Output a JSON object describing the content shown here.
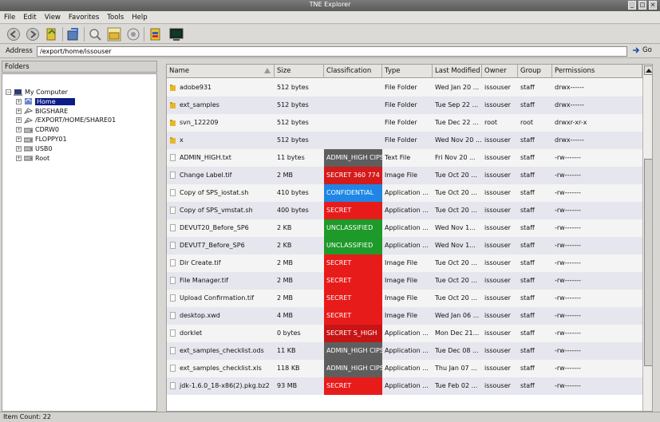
{
  "window": {
    "title": "TNE Explorer"
  },
  "menu": [
    "File",
    "Edit",
    "View",
    "Favorites",
    "Tools",
    "Help"
  ],
  "address": {
    "label": "Address",
    "value": "/export/home/issouser",
    "go_label": "Go"
  },
  "folders": {
    "header": "Folders",
    "tree": [
      {
        "label": "My Computer",
        "depth": 0,
        "expander": "−",
        "icon": "computer-icon",
        "selected": false
      },
      {
        "label": "Home",
        "depth": 1,
        "expander": "+",
        "icon": "home-icon",
        "selected": true
      },
      {
        "label": "BIGSHARE",
        "depth": 1,
        "expander": "+",
        "icon": "share-icon",
        "selected": false
      },
      {
        "label": "/EXPORT/HOME/SHARE01",
        "depth": 1,
        "expander": "+",
        "icon": "share-icon",
        "selected": false
      },
      {
        "label": "CDRW0",
        "depth": 1,
        "expander": "+",
        "icon": "drive-icon",
        "selected": false
      },
      {
        "label": "FLOPPY01",
        "depth": 1,
        "expander": "+",
        "icon": "drive-icon",
        "selected": false
      },
      {
        "label": "USB0",
        "depth": 1,
        "expander": "+",
        "icon": "drive-icon",
        "selected": false
      },
      {
        "label": "Root",
        "depth": 1,
        "expander": "+",
        "icon": "drive-icon",
        "selected": false
      }
    ]
  },
  "table": {
    "columns": [
      "Name",
      "Size",
      "Classification",
      "Type",
      "Last Modified",
      "Owner",
      "Group",
      "Permissions"
    ],
    "rows": [
      {
        "name": "adobe931",
        "kind": "folder",
        "size": "512 bytes",
        "class": "",
        "class_color": "",
        "type": "File Folder",
        "modified": "Wed Jan 20 ...",
        "owner": "issouser",
        "group": "staff",
        "perm": "drwx------"
      },
      {
        "name": "ext_samples",
        "kind": "folder",
        "size": "512 bytes",
        "class": "",
        "class_color": "",
        "type": "File Folder",
        "modified": "Tue Sep 22 ...",
        "owner": "issouser",
        "group": "staff",
        "perm": "drwx------"
      },
      {
        "name": "svn_122209",
        "kind": "folder",
        "size": "512 bytes",
        "class": "",
        "class_color": "",
        "type": "File Folder",
        "modified": "Tue Dec 22 ...",
        "owner": "root",
        "group": "root",
        "perm": "drwxr-xr-x"
      },
      {
        "name": "x",
        "kind": "folder",
        "size": "512 bytes",
        "class": "",
        "class_color": "",
        "type": "File Folder",
        "modified": "Wed Nov 20 ...",
        "owner": "issouser",
        "group": "staff",
        "perm": "drwx------"
      },
      {
        "name": "ADMIN_HIGH.txt",
        "kind": "file",
        "size": "11 bytes",
        "class": "ADMIN_HIGH CIPS",
        "class_color": "#5e5e5e",
        "type": "Text File",
        "modified": "Fri Nov 20 ...",
        "owner": "issouser",
        "group": "staff",
        "perm": "-rw-------"
      },
      {
        "name": "Change Label.tif",
        "kind": "file",
        "size": "2 MB",
        "class": "SECRET 360 774",
        "class_color": "#d41a1a",
        "type": "Image File",
        "modified": "Tue Oct 20 ...",
        "owner": "issouser",
        "group": "staff",
        "perm": "-rw-------"
      },
      {
        "name": "Copy of SPS_iostat.sh",
        "kind": "file",
        "size": "410 bytes",
        "class": "CONFIDENTIAL",
        "class_color": "#1f86e6",
        "type": "Application ...",
        "modified": "Tue Oct 20 ...",
        "owner": "issouser",
        "group": "staff",
        "perm": "-rw-------"
      },
      {
        "name": "Copy of SPS_vmstat.sh",
        "kind": "file",
        "size": "400 bytes",
        "class": "SECRET",
        "class_color": "#e81b1b",
        "type": "Application ...",
        "modified": "Tue Oct 20 ...",
        "owner": "issouser",
        "group": "staff",
        "perm": "-rw-------"
      },
      {
        "name": "DEVUT20_Before_SP6",
        "kind": "file",
        "size": "2 KB",
        "class": "UNCLASSIFIED",
        "class_color": "#1e9a2a",
        "type": "Application ...",
        "modified": "Wed Nov 1...",
        "owner": "issouser",
        "group": "staff",
        "perm": "-rw-------"
      },
      {
        "name": "DEVUT7_Before_SP6",
        "kind": "file",
        "size": "2 KB",
        "class": "UNCLASSIFIED",
        "class_color": "#1e9a2a",
        "type": "Application ...",
        "modified": "Wed Nov 1...",
        "owner": "issouser",
        "group": "staff",
        "perm": "-rw-------"
      },
      {
        "name": "Dir Create.tif",
        "kind": "file",
        "size": "2 MB",
        "class": "SECRET",
        "class_color": "#e81b1b",
        "type": "Image File",
        "modified": "Tue Oct 20 ...",
        "owner": "issouser",
        "group": "staff",
        "perm": "-rw-------"
      },
      {
        "name": "File Manager.tif",
        "kind": "file",
        "size": "2 MB",
        "class": "SECRET",
        "class_color": "#e81b1b",
        "type": "Image File",
        "modified": "Tue Oct 20 ...",
        "owner": "issouser",
        "group": "staff",
        "perm": "-rw-------"
      },
      {
        "name": "Upload Confirmation.tif",
        "kind": "file",
        "size": "2 MB",
        "class": "SECRET",
        "class_color": "#e81b1b",
        "type": "Image File",
        "modified": "Tue Oct 20 ...",
        "owner": "issouser",
        "group": "staff",
        "perm": "-rw-------"
      },
      {
        "name": "desktop.xwd",
        "kind": "file",
        "size": "4 MB",
        "class": "SECRET",
        "class_color": "#e81b1b",
        "type": "Image File",
        "modified": "Wed Jan 06 ...",
        "owner": "issouser",
        "group": "staff",
        "perm": "-rw-------"
      },
      {
        "name": "dorklet",
        "kind": "file",
        "size": "0 bytes",
        "class": "SECRET S_HIGH",
        "class_color": "#c81414",
        "type": "Application ...",
        "modified": "Mon Dec 21...",
        "owner": "issouser",
        "group": "staff",
        "perm": "-rw-------"
      },
      {
        "name": "ext_samples_checklist.ods",
        "kind": "file",
        "size": "11 KB",
        "class": "ADMIN_HIGH CIPS",
        "class_color": "#5e5e5e",
        "type": "Application ...",
        "modified": "Tue Dec 08 ...",
        "owner": "issouser",
        "group": "staff",
        "perm": "-rw-------"
      },
      {
        "name": "ext_samples_checklist.xls",
        "kind": "file",
        "size": "118 KB",
        "class": "ADMIN_HIGH CIPS",
        "class_color": "#5e5e5e",
        "type": "Application ...",
        "modified": "Thu Jan 07 ...",
        "owner": "issouser",
        "group": "staff",
        "perm": "-rw-------"
      },
      {
        "name": "jdk-1.6.0_18-x86(2).pkg.bz2",
        "kind": "file",
        "size": "93 MB",
        "class": "SECRET",
        "class_color": "#e81b1b",
        "type": "Application ...",
        "modified": "Tue Feb 02 ...",
        "owner": "issouser",
        "group": "staff",
        "perm": "-rw-------"
      }
    ]
  },
  "status": {
    "text": "Item Count: 22"
  }
}
